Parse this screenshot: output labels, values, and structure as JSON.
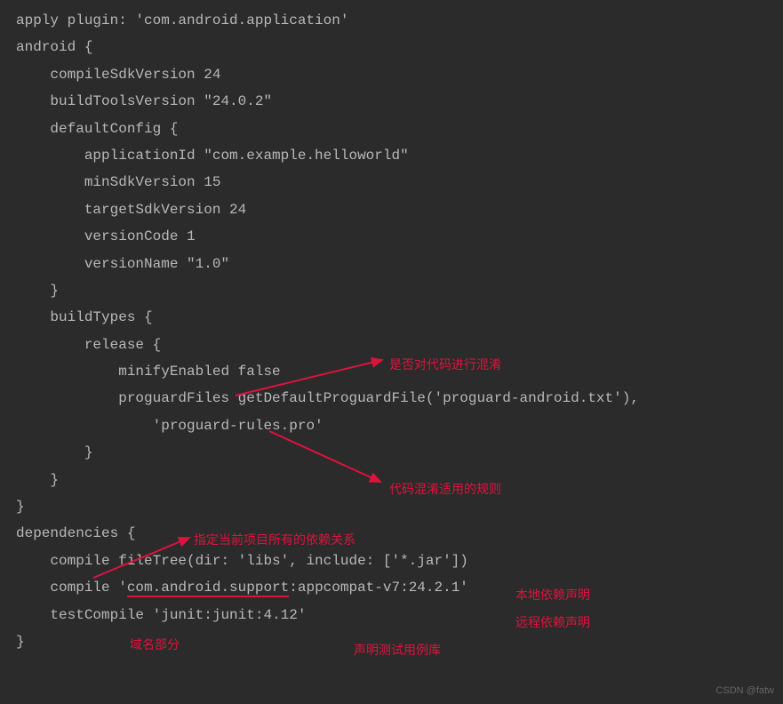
{
  "code": {
    "l1": "apply plugin: 'com.android.application'",
    "l2": "android {",
    "l3": "    compileSdkVersion 24",
    "l4": "    buildToolsVersion \"24.0.2\"",
    "l5": "    defaultConfig {",
    "l6": "        applicationId \"com.example.helloworld\"",
    "l7": "        minSdkVersion 15",
    "l8": "        targetSdkVersion 24",
    "l9": "        versionCode 1",
    "l10": "        versionName \"1.0\"",
    "l11": "    }",
    "l12": "    buildTypes {",
    "l13": "        release {",
    "l14": "            minifyEnabled false",
    "l15": "            proguardFiles getDefaultProguardFile('proguard-android.txt'),",
    "l16": "                'proguard-rules.pro'",
    "l17": "        }",
    "l18": "    }",
    "l19": "}",
    "l20": "dependencies {",
    "l21a": "    compile fileTree(dir: 'libs', include: ['*.jar'])",
    "l22a": "    compile '",
    "l22b": "com.android.support",
    "l22c": ":appcompat-v7:24.2.1'",
    "l23a": "    testCompile 'junit:junit:4.12'",
    "l24": "}"
  },
  "annotations": {
    "a1": "是否对代码进行混淆",
    "a2": "代码混淆适用的规则",
    "a3": "指定当前项目所有的依赖关系",
    "a4": "本地依赖声明",
    "a5": "远程依赖声明",
    "a6": "域名部分",
    "a7": "声明测试用例库"
  },
  "watermark": "CSDN @fatw"
}
